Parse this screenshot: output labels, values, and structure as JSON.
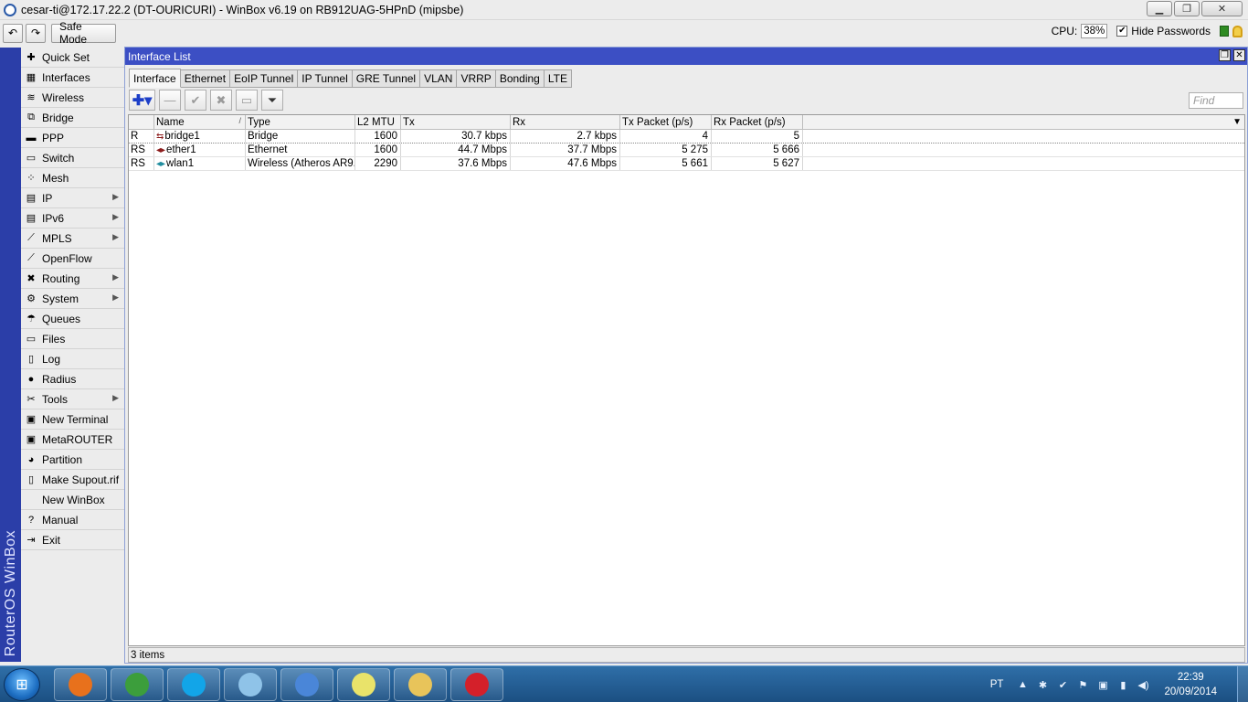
{
  "window": {
    "title": "cesar-ti@172.17.22.2 (DT-OURICURI) - WinBox v6.19 on RB912UAG-5HPnD (mipsbe)",
    "min": "▁",
    "max": "❐",
    "close": "✕"
  },
  "toolbar": {
    "undo": "↶",
    "redo": "↷",
    "safe_mode": "Safe Mode",
    "cpu_label": "CPU:",
    "cpu_value": "38%",
    "hide_passwords_check": "✔",
    "hide_passwords": "Hide Passwords"
  },
  "brand": "RouterOS WinBox",
  "menu": [
    {
      "label": "Quick Set",
      "icon": "quick-set-icon",
      "glyph": "✚",
      "submenu": false
    },
    {
      "label": "Interfaces",
      "icon": "interfaces-icon",
      "glyph": "▦",
      "submenu": false
    },
    {
      "label": "Wireless",
      "icon": "wireless-icon",
      "glyph": "≋",
      "submenu": false
    },
    {
      "label": "Bridge",
      "icon": "bridge-icon",
      "glyph": "⧉",
      "submenu": false
    },
    {
      "label": "PPP",
      "icon": "ppp-icon",
      "glyph": "▬",
      "submenu": false
    },
    {
      "label": "Switch",
      "icon": "switch-icon",
      "glyph": "▭",
      "submenu": false
    },
    {
      "label": "Mesh",
      "icon": "mesh-icon",
      "glyph": "⁘",
      "submenu": false
    },
    {
      "label": "IP",
      "icon": "ip-icon",
      "glyph": "▤",
      "submenu": true
    },
    {
      "label": "IPv6",
      "icon": "ipv6-icon",
      "glyph": "▤",
      "submenu": true
    },
    {
      "label": "MPLS",
      "icon": "mpls-icon",
      "glyph": "⟋",
      "submenu": true
    },
    {
      "label": "OpenFlow",
      "icon": "openflow-icon",
      "glyph": "⟋",
      "submenu": false
    },
    {
      "label": "Routing",
      "icon": "routing-icon",
      "glyph": "✖",
      "submenu": true
    },
    {
      "label": "System",
      "icon": "system-icon",
      "glyph": "⚙",
      "submenu": true
    },
    {
      "label": "Queues",
      "icon": "queues-icon",
      "glyph": "☂",
      "submenu": false
    },
    {
      "label": "Files",
      "icon": "files-icon",
      "glyph": "▭",
      "submenu": false
    },
    {
      "label": "Log",
      "icon": "log-icon",
      "glyph": "▯",
      "submenu": false
    },
    {
      "label": "Radius",
      "icon": "radius-icon",
      "glyph": "●",
      "submenu": false
    },
    {
      "label": "Tools",
      "icon": "tools-icon",
      "glyph": "✂",
      "submenu": true
    },
    {
      "label": "New Terminal",
      "icon": "terminal-icon",
      "glyph": "▣",
      "submenu": false
    },
    {
      "label": "MetaROUTER",
      "icon": "metarouter-icon",
      "glyph": "▣",
      "submenu": false
    },
    {
      "label": "Partition",
      "icon": "partition-icon",
      "glyph": "◕",
      "submenu": false
    },
    {
      "label": "Make Supout.rif",
      "icon": "supout-icon",
      "glyph": "▯",
      "submenu": false
    },
    {
      "label": "New WinBox",
      "icon": "",
      "glyph": "",
      "submenu": false
    },
    {
      "label": "Manual",
      "icon": "manual-icon",
      "glyph": "?",
      "submenu": false
    },
    {
      "label": "Exit",
      "icon": "exit-icon",
      "glyph": "⇥",
      "submenu": false
    }
  ],
  "submenu_arrow": "▶",
  "interface_list": {
    "title": "Interface List",
    "restore_btn": "❐",
    "close_btn": "✕",
    "tabs": [
      "Interface",
      "Ethernet",
      "EoIP Tunnel",
      "IP Tunnel",
      "GRE Tunnel",
      "VLAN",
      "VRRP",
      "Bonding",
      "LTE"
    ],
    "active_tab": 0,
    "tools": {
      "add": "✚▾",
      "remove": "—",
      "enable": "✔",
      "disable": "✖",
      "comment": "▭",
      "filter": "⏷"
    },
    "find_placeholder": "Find",
    "columns": [
      "",
      "Name",
      "Type",
      "L2 MTU",
      "Tx",
      "Rx",
      "Tx Packet (p/s)",
      "Rx Packet (p/s)"
    ],
    "sort_mark": "/",
    "column_dropdown": "▼",
    "rows": [
      {
        "flags": "R",
        "icon": "bridge-interface-icon",
        "glyph": "⇆",
        "name": "bridge1",
        "type": "Bridge",
        "l2mtu": "1600",
        "tx": "30.7 kbps",
        "rx": "2.7 kbps",
        "txp": "4",
        "rxp": "5"
      },
      {
        "flags": "RS",
        "icon": "ethernet-interface-icon",
        "glyph": "◂▸",
        "name": "ether1",
        "type": "Ethernet",
        "l2mtu": "1600",
        "tx": "44.7 Mbps",
        "rx": "37.7 Mbps",
        "txp": "5 275",
        "rxp": "5 666"
      },
      {
        "flags": "RS",
        "icon": "wireless-interface-icon",
        "glyph": "◂▸",
        "name": "wlan1",
        "type": "Wireless (Atheros AR9...",
        "l2mtu": "2290",
        "tx": "37.6 Mbps",
        "rx": "47.6 Mbps",
        "txp": "5 661",
        "rxp": "5 627"
      }
    ],
    "status": "3 items"
  },
  "taskbar": {
    "start_glyph": "⊞",
    "apps": [
      {
        "name": "firefox",
        "color": "#e8711c"
      },
      {
        "name": "chrome",
        "color": "#3c9e3c"
      },
      {
        "name": "skype",
        "color": "#12a5e8"
      },
      {
        "name": "notepad",
        "color": "#8fc3e8"
      },
      {
        "name": "winbox",
        "color": "#4a86d8"
      },
      {
        "name": "sticky-notes",
        "color": "#e9e36a"
      },
      {
        "name": "explorer",
        "color": "#e8c45a"
      },
      {
        "name": "opera",
        "color": "#d4202a"
      }
    ],
    "lang": "PT",
    "tray_icons": [
      "▲",
      "✱",
      "✔",
      "⚑",
      "▣",
      "▮",
      "◀)"
    ],
    "time": "22:39",
    "date": "20/09/2014"
  }
}
